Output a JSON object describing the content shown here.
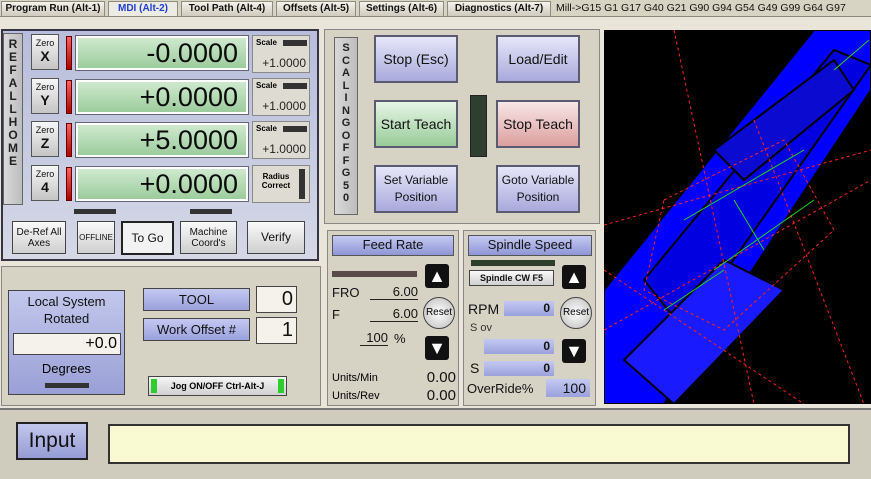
{
  "tabs": [
    {
      "label": "Program Run (Alt-1)",
      "active": false
    },
    {
      "label": "MDI (Alt-2)",
      "active": true
    },
    {
      "label": "Tool Path (Alt-4)",
      "active": false
    },
    {
      "label": "Offsets (Alt-5)",
      "active": false
    },
    {
      "label": "Settings (Alt-6)",
      "active": false
    },
    {
      "label": "Diagnostics (Alt-7)",
      "active": false
    }
  ],
  "gcode_status": "Mill->G15  G1 G17 G40 G21 G90 G94 G54 G49 G99 G64 G97",
  "ref_all_home": "REF ALL HOME",
  "axes": [
    {
      "zero_label": "Zero",
      "axis": "X",
      "value": "-0.0000",
      "side_label": "Scale",
      "side_value": "+1.0000"
    },
    {
      "zero_label": "Zero",
      "axis": "Y",
      "value": "+0.0000",
      "side_label": "Scale",
      "side_value": "+1.0000"
    },
    {
      "zero_label": "Zero",
      "axis": "Z",
      "value": "+5.0000",
      "side_label": "Scale",
      "side_value": "+1.0000"
    },
    {
      "zero_label": "Zero",
      "axis": "4",
      "value": "+0.0000",
      "side_label": "Radius Correct",
      "side_value": ""
    }
  ],
  "dro_buttons": {
    "deref": "De-Ref All Axes",
    "offline": "OFFLINE",
    "togo": "To Go",
    "machine": "Machine Coord's",
    "verify": "Verify"
  },
  "control_buttons": {
    "stop": "Stop (Esc)",
    "load": "Load/Edit",
    "start_teach": "Start Teach",
    "stop_teach": "Stop Teach",
    "set_var": "Set Variable Position",
    "goto_var": "Goto Variable Position"
  },
  "scaling": "SCALING OFF G50",
  "local_system": {
    "title": "Local System Rotated",
    "value": "+0.0",
    "units": "Degrees"
  },
  "tool": {
    "label": "TOOL",
    "value": "0"
  },
  "work_offset": {
    "label": "Work Offset #",
    "value": "1"
  },
  "jog_button": "Jog ON/OFF Ctrl-Alt-J",
  "feed": {
    "title": "Feed Rate",
    "fro_label": "FRO",
    "fro_value": "6.00",
    "f_label": "F",
    "f_value": "6.00",
    "percent_value": "100",
    "percent_sign": "%",
    "reset": "Reset",
    "units_min_label": "Units/Min",
    "units_min_value": "0.00",
    "units_rev_label": "Units/Rev",
    "units_rev_value": "0.00"
  },
  "spindle": {
    "title": "Spindle Speed",
    "cw_button": "Spindle CW F5",
    "rpm_label": "RPM",
    "rpm_value": "0",
    "sov_label": "S ov",
    "sov_value": "0",
    "s_label": "S",
    "s_value": "0",
    "override_label": "OverRide%",
    "override_value": "100",
    "reset": "Reset"
  },
  "input": {
    "label": "Input",
    "value": ""
  },
  "colors": {
    "dro_bg": "#9ccc9c",
    "panel_blue": "#9aa1dc",
    "toolpath_blue": "#0000ff",
    "toolpath_red": "#ff2020"
  },
  "icons": [
    "plus-up-arrow-icon",
    "minus-down-arrow-icon"
  ]
}
